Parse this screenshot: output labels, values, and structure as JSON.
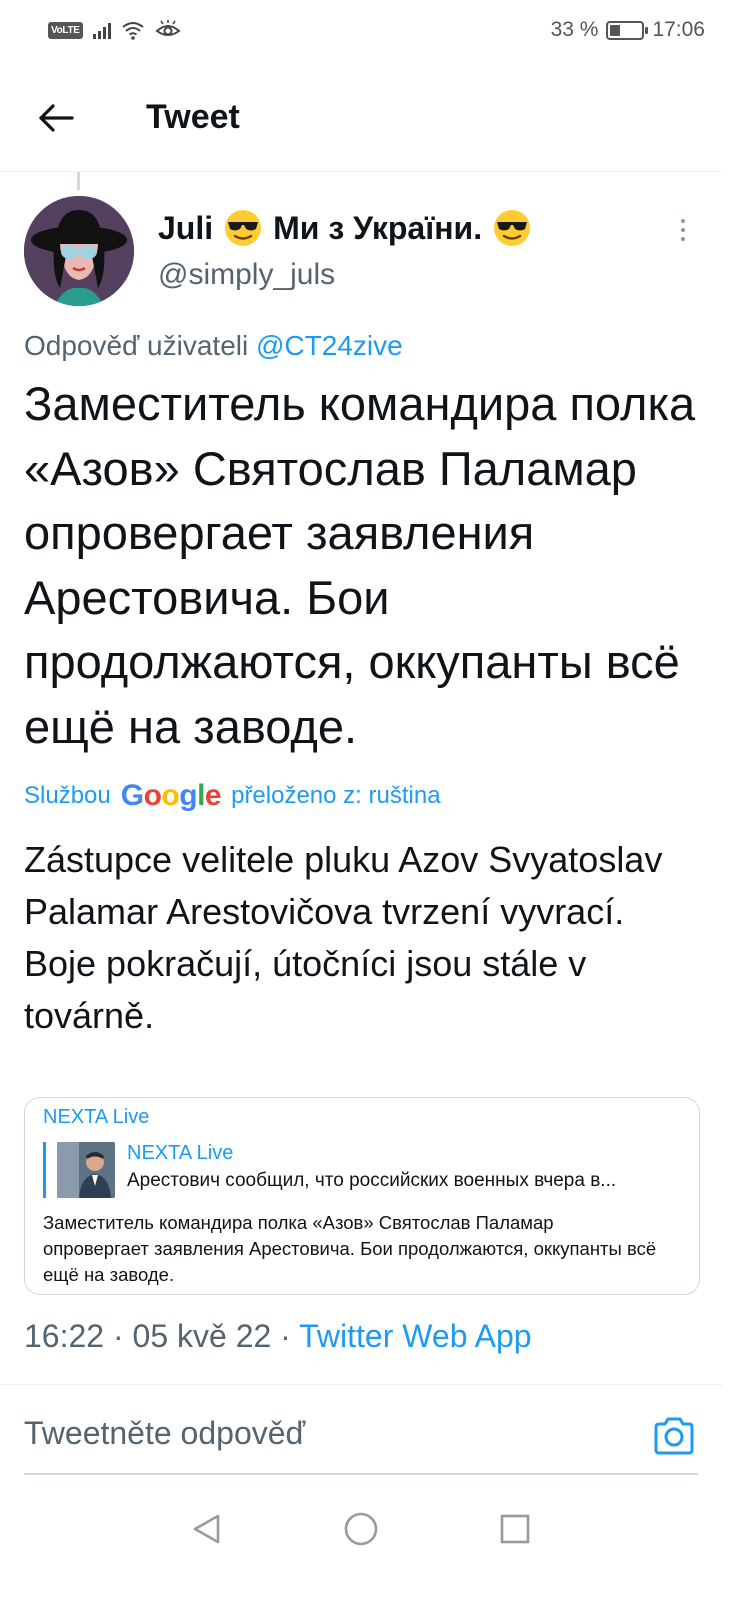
{
  "status_bar": {
    "network": "VoLTE",
    "battery_percent": "33 %",
    "battery_level": 0.33,
    "time": "17:06"
  },
  "header": {
    "title": "Tweet"
  },
  "tweet": {
    "author_name": "Juli",
    "author_name_suffix": "Ми з України.",
    "author_handle": "@simply_juls",
    "reply_prefix": "Odpověď uživateli",
    "reply_mention": "@CT24zive",
    "text": "Заместитель командира полка «Азов» Святослав Паламар опровергает заявления Арестовича. Бои продолжаются, оккупанты всё ещё на заводе.",
    "translation_prefix": "Službou",
    "translation_provider": "Google",
    "translation_suffix": "přeloženo z: ruština",
    "translation_text": "Zástupce velitele pluku Azov Svyatoslav Palamar Arestovičova tvrzení vyvrací. Boje pokračují, útočníci jsou stále v továrně.",
    "quoted": {
      "author": "NEXTA Live",
      "inner_author": "NEXTA Live",
      "inner_text": "Арестович сообщил, что российских военных вчера в...",
      "text": "Заместитель командира полка «Азов» Святослав Паламар опровергает заявления Арестовича. Бои продолжаются, оккупанты всё ещё на заводе."
    },
    "time": "16:22",
    "date": "05 kvě 22",
    "source": "Twitter Web App"
  },
  "reply": {
    "placeholder": "Tweetněte odpověď"
  },
  "icons": {
    "back": "arrow-left-icon",
    "more": "more-vertical-icon",
    "camera": "camera-icon",
    "nav_back": "triangle-back-icon",
    "nav_home": "circle-home-icon",
    "nav_recents": "square-recents-icon"
  },
  "colors": {
    "accent": "#1d9bf0",
    "text": "#0f1419",
    "muted": "#536471"
  }
}
